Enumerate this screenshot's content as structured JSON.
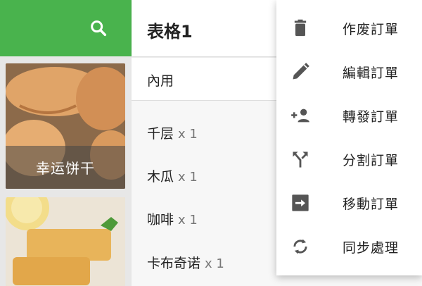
{
  "header": {
    "title": "表格1"
  },
  "order": {
    "section_label": "內用",
    "items": [
      {
        "name": "千层",
        "qty": "x 1"
      },
      {
        "name": "木瓜",
        "qty": "x 1"
      },
      {
        "name": "咖啡",
        "qty": "x 1"
      },
      {
        "name": "卡布奇诺",
        "qty": "x 1"
      }
    ]
  },
  "products": [
    {
      "label": "幸运饼干"
    }
  ],
  "menu": {
    "items": [
      {
        "label": "作废訂單",
        "icon": "trash-icon"
      },
      {
        "label": "編輯訂單",
        "icon": "pencil-icon"
      },
      {
        "label": "轉發訂單",
        "icon": "person-forward-icon"
      },
      {
        "label": "分割訂單",
        "icon": "split-icon"
      },
      {
        "label": "移動訂單",
        "icon": "move-icon"
      },
      {
        "label": "同步處理",
        "icon": "sync-icon"
      }
    ]
  },
  "colors": {
    "accent": "#49b34d",
    "icon": "#555555"
  }
}
